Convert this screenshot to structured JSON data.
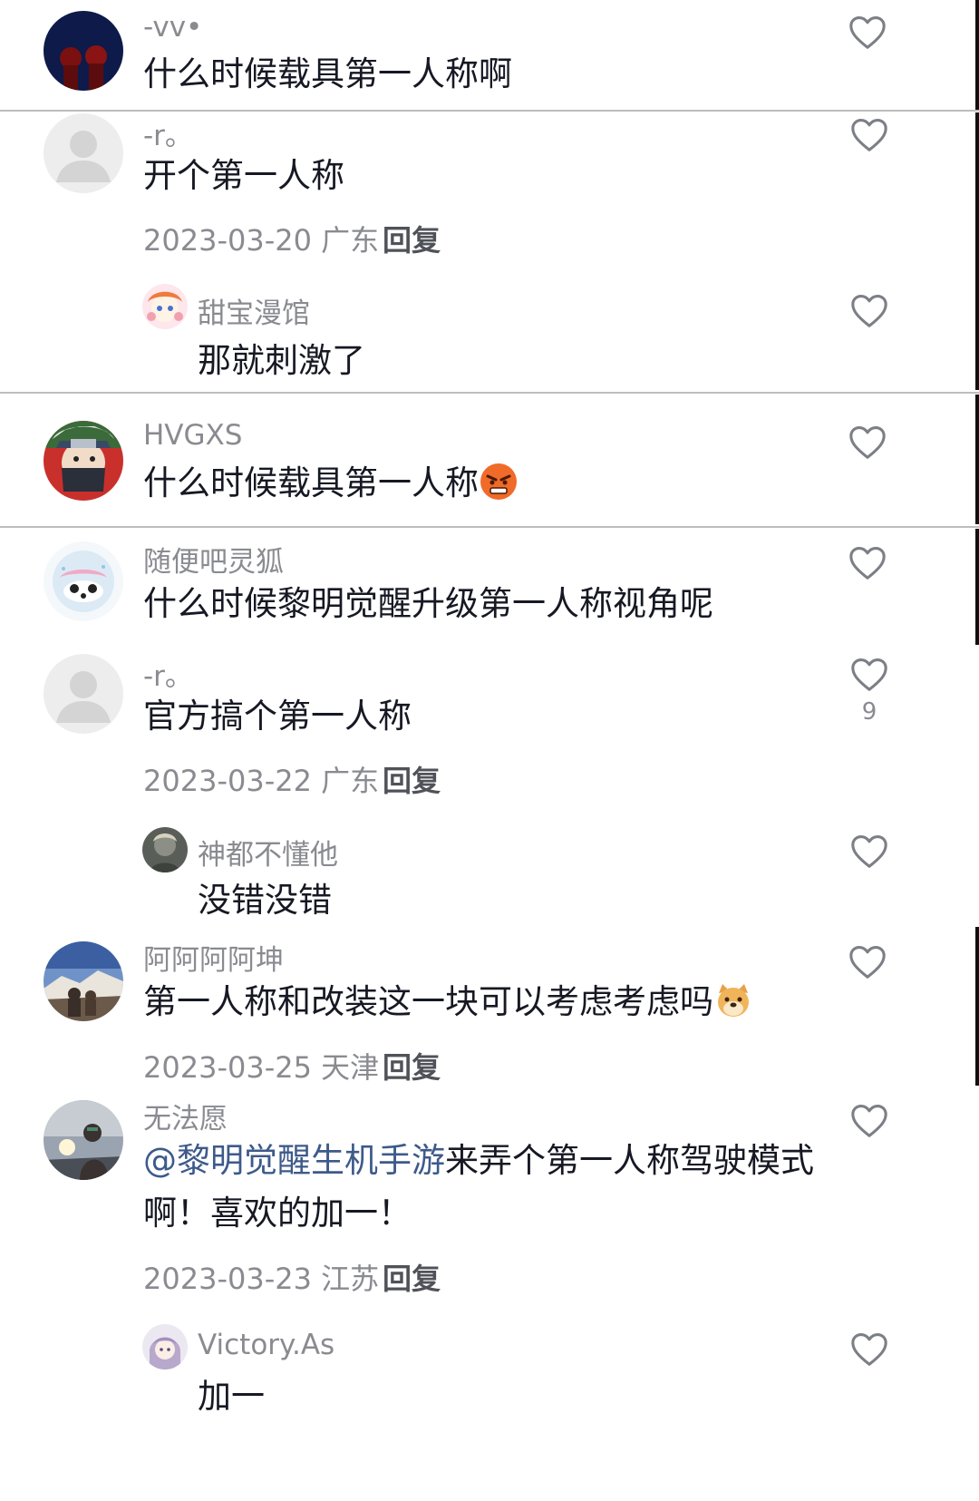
{
  "comments": [
    {
      "user": "-vv•",
      "text": "什么时候载具第一人称啊"
    },
    {
      "user": "-r。",
      "text": "开个第一人称",
      "date": "2023-03-20",
      "region": "广东",
      "reply": "回复",
      "sub": {
        "user": "甜宝漫馆",
        "text": "那就刺激了"
      }
    },
    {
      "user": "HVGXS",
      "text": "什么时候载具第一人称",
      "emoji": "angry-face-emoji"
    },
    {
      "user": "随便吧灵狐",
      "text": "什么时候黎明觉醒升级第一人称视角呢"
    },
    {
      "user": "-r。",
      "text": "官方搞个第一人称",
      "likes": "9",
      "date": "2023-03-22",
      "region": "广东",
      "reply": "回复",
      "sub": {
        "user": "神都不懂他",
        "text": "没错没错"
      }
    },
    {
      "user": "阿阿阿阿坤",
      "text": "第一人称和改装这一块可以考虑考虑吗",
      "emoji": "doge-emoji",
      "date": "2023-03-25",
      "region": "天津",
      "reply": "回复"
    },
    {
      "user": "无法愿",
      "mention": "@黎明觉醒生机手游",
      "text": "来弄个第一人称驾驶模式",
      "text2": "啊！喜欢的加一！",
      "date": "2023-03-23",
      "region": "江苏",
      "reply": "回复",
      "sub": {
        "user": "Victory.As",
        "text": "加一"
      }
    }
  ]
}
